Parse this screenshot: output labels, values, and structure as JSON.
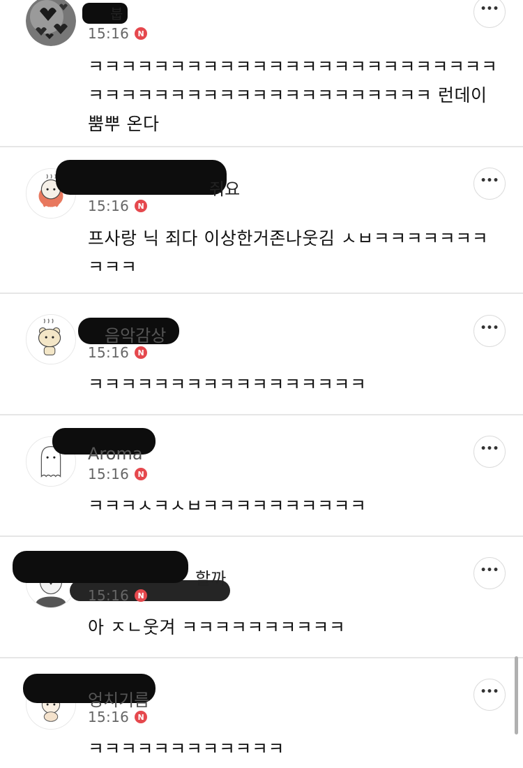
{
  "comments": [
    {
      "name": "붑",
      "time": "15:16",
      "badge": "N",
      "avatar": "butterfly-avatar",
      "text": "ㅋㅋㅋㅋㅋㅋㅋㅋㅋㅋㅋㅋㅋㅋㅋㅋㅋㅋㅋㅋㅋㅋㅋㅋㅋㅋㅋㅋㅋㅋㅋㅋㅋㅋㅋㅋㅋㅋㅋㅋㅋㅋㅋㅋㅋㅋ 런데이 뿜뿌 온다"
    },
    {
      "name": "줘요",
      "time": "15:16",
      "badge": "N",
      "avatar": "octopus-avatar",
      "text": "프사랑 닉 죄다 이상한거존나웃김 ㅅㅂㅋㅋㅋㅋㅋㅋㅋㅋㅋㅋ"
    },
    {
      "name": "음악감상",
      "time": "15:16",
      "badge": "N",
      "avatar": "bear-avatar",
      "text": "ㅋㅋㅋㅋㅋㅋㅋㅋㅋㅋㅋㅋㅋㅋㅋㅋㅋ"
    },
    {
      "name": "Aroma",
      "time": "15:16",
      "badge": "N",
      "avatar": "ghost-avatar",
      "text": "ㅋㅋㅋㅅㅋㅅㅂㅋㅋㅋㅋㅋㅋㅋㅋㅋㅋ"
    },
    {
      "name": "할까",
      "time": "15:16",
      "badge": "N",
      "avatar": "penguin-avatar",
      "text": "아 ㅈㄴ웃겨 ㅋㅋㅋㅋㅋㅋㅋㅋㅋㅋ"
    },
    {
      "name": "엉치기름",
      "time": "15:16",
      "badge": "N",
      "avatar": "doll-avatar",
      "text": "ㅋㅋㅋㅋㅋㅋㅋㅋㅋㅋㅋㅋ"
    }
  ],
  "more_button_label": "•••",
  "colors": {
    "badge": "#e5484d",
    "divider": "#e6e6e6",
    "time": "#666666"
  }
}
